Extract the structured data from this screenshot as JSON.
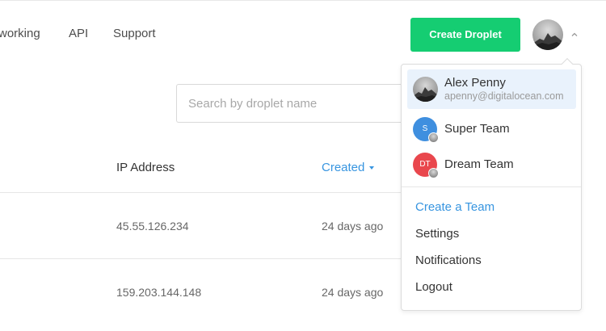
{
  "nav": {
    "items": [
      "working",
      "API",
      "Support"
    ],
    "create_button": "Create Droplet",
    "avatar_icon": "user-avatar-mountain",
    "menu_chevron_icon": "chevron-up-icon"
  },
  "search": {
    "placeholder": "Search by droplet name",
    "value": ""
  },
  "table": {
    "columns": [
      "IP Address",
      "Created"
    ],
    "sorted_column": "Created",
    "sort_direction": "desc",
    "rows": [
      {
        "ip": "45.55.126.234",
        "created": "24 days ago"
      },
      {
        "ip": "159.203.144.148",
        "created": "24 days ago"
      }
    ]
  },
  "account_menu": {
    "user": {
      "name": "Alex Penny",
      "email": "apenny@digitalocean.com"
    },
    "teams": [
      {
        "initials": "S",
        "name": "Super Team",
        "color": "#3f8fdf"
      },
      {
        "initials": "DT",
        "name": "Dream Team",
        "color": "#e9474d"
      }
    ],
    "items": [
      "Create a Team",
      "Settings",
      "Notifications",
      "Logout"
    ]
  },
  "colors": {
    "primary_green": "#15cd72",
    "link_blue": "#3795e0",
    "selected_bg": "#e9f2fc"
  }
}
